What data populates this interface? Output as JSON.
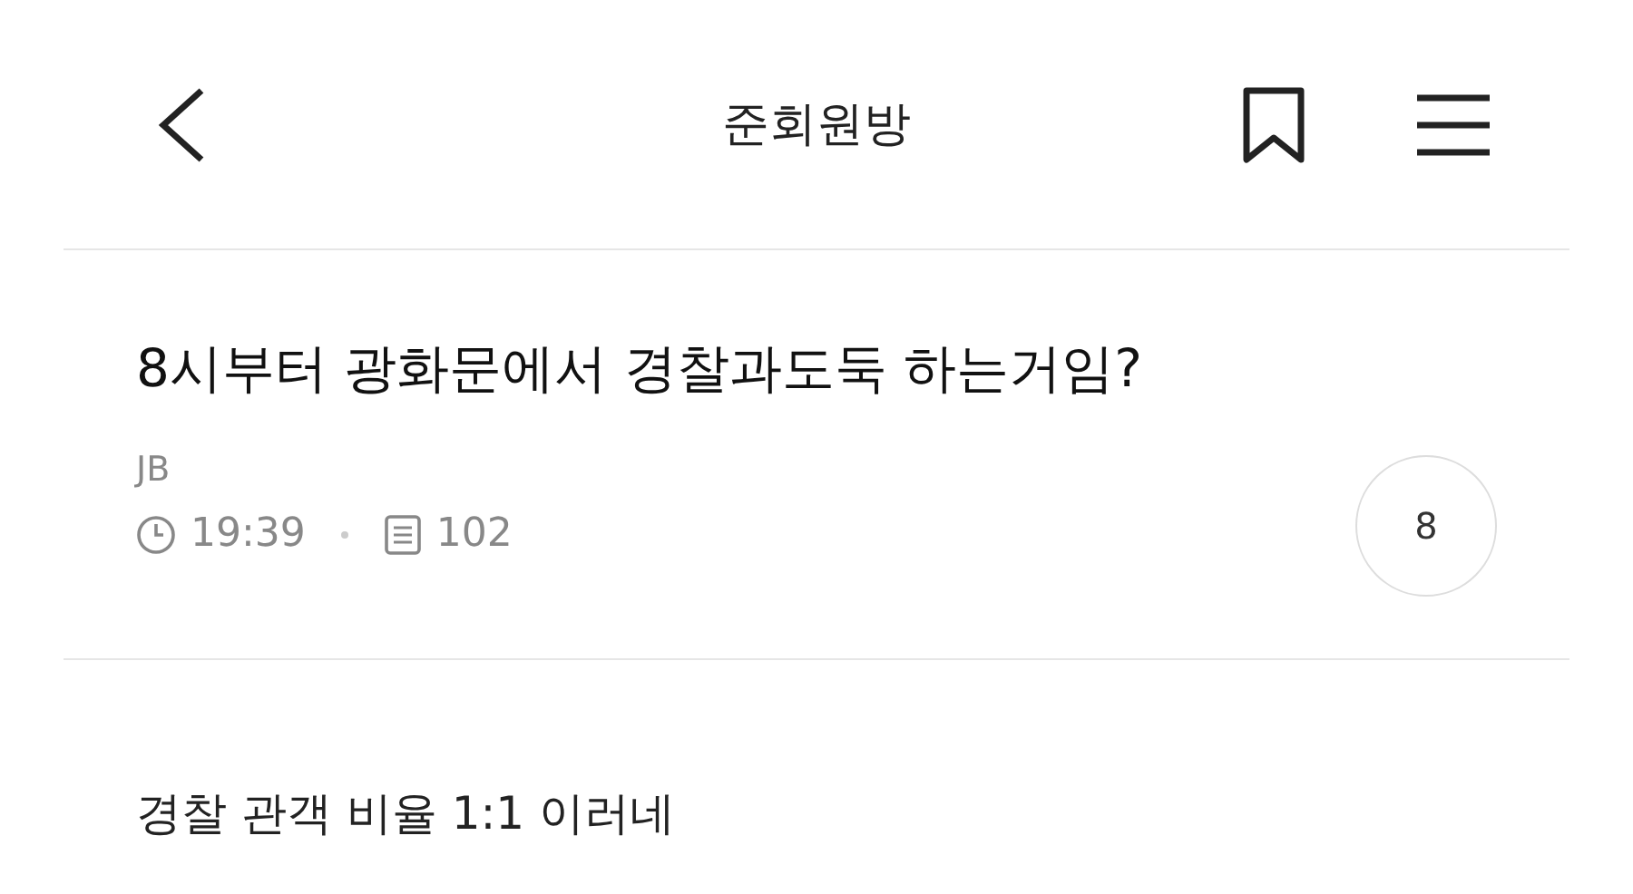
{
  "header": {
    "title": "준회원방"
  },
  "post": {
    "title": "8시부터 광화문에서 경찰과도둑 하는거임?",
    "author": "JB",
    "time": "19:39",
    "views": "102",
    "comment_count": "8"
  },
  "body": "경찰 관객 비율 1:1 이러네"
}
